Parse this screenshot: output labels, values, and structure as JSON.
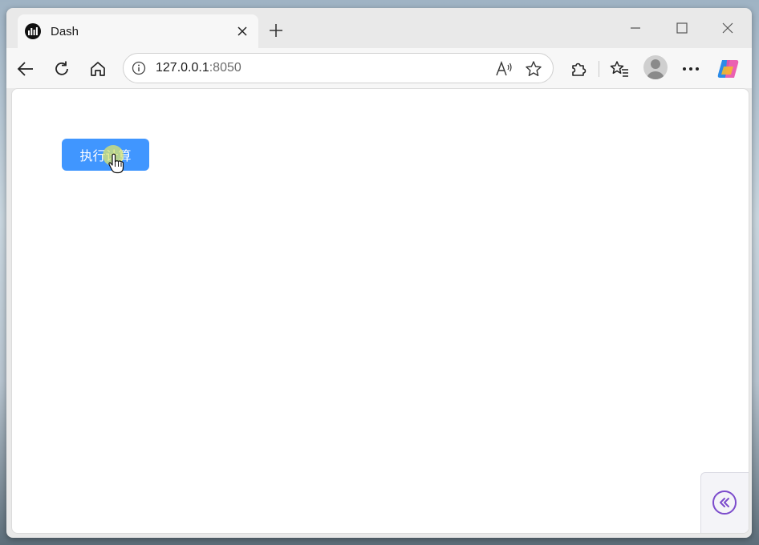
{
  "tab": {
    "title": "Dash",
    "favicon": "dash-logo-icon"
  },
  "address_bar": {
    "host": "127.0.0.1",
    "port": ":8050"
  },
  "page": {
    "run_button_label": "执行计算"
  },
  "colors": {
    "primary_button": "#4096ff",
    "devtools_accent": "#7c4ccc"
  },
  "icons": [
    "back-icon",
    "refresh-icon",
    "home-icon",
    "info-icon",
    "read-aloud-icon",
    "favorite-star-icon",
    "extensions-icon",
    "favorites-icon",
    "profile-icon",
    "more-icon",
    "copilot-icon",
    "minimize-icon",
    "maximize-icon",
    "close-icon",
    "plus-icon",
    "devtools-collapse-icon"
  ]
}
